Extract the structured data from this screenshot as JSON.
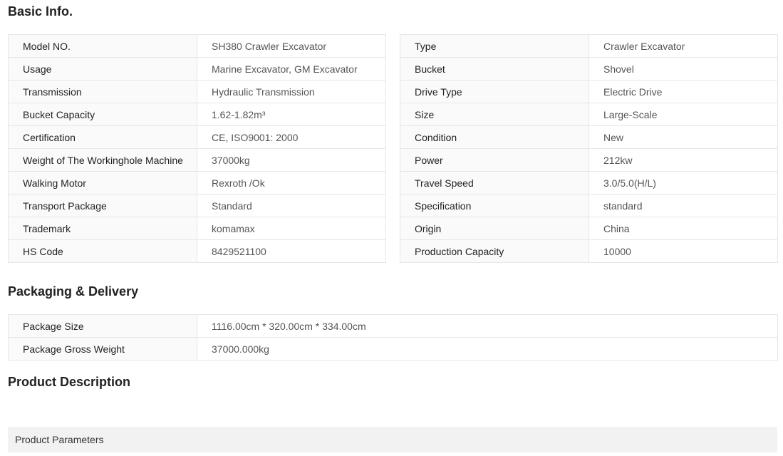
{
  "basic_info": {
    "title": "Basic Info.",
    "left": [
      {
        "label": "Model NO.",
        "value": "SH380 Crawler Excavator"
      },
      {
        "label": "Usage",
        "value": "Marine Excavator, GM Excavator"
      },
      {
        "label": "Transmission",
        "value": "Hydraulic Transmission"
      },
      {
        "label": "Bucket Capacity",
        "value": "1.62-1.82m³"
      },
      {
        "label": "Certification",
        "value": "CE, ISO9001: 2000"
      },
      {
        "label": "Weight of The Workinghole Machine",
        "value": "37000kg"
      },
      {
        "label": "Walking Motor",
        "value": "Rexroth /Ok"
      },
      {
        "label": "Transport Package",
        "value": "Standard"
      },
      {
        "label": "Trademark",
        "value": "komamax"
      },
      {
        "label": "HS Code",
        "value": "8429521100"
      }
    ],
    "right": [
      {
        "label": "Type",
        "value": "Crawler Excavator"
      },
      {
        "label": "Bucket",
        "value": "Shovel"
      },
      {
        "label": "Drive Type",
        "value": "Electric Drive"
      },
      {
        "label": "Size",
        "value": "Large-Scale"
      },
      {
        "label": "Condition",
        "value": "New"
      },
      {
        "label": "Power",
        "value": "212kw"
      },
      {
        "label": "Travel Speed",
        "value": "3.0/5.0(H/L)"
      },
      {
        "label": "Specification",
        "value": "standard"
      },
      {
        "label": "Origin",
        "value": "China"
      },
      {
        "label": "Production Capacity",
        "value": "10000"
      }
    ]
  },
  "packaging": {
    "title": "Packaging & Delivery",
    "rows": [
      {
        "label": "Package Size",
        "value": "1116.00cm * 320.00cm * 334.00cm"
      },
      {
        "label": "Package Gross Weight",
        "value": "37000.000kg"
      }
    ]
  },
  "product_description": {
    "title": "Product Description",
    "parameters_label": "Product Parameters"
  }
}
